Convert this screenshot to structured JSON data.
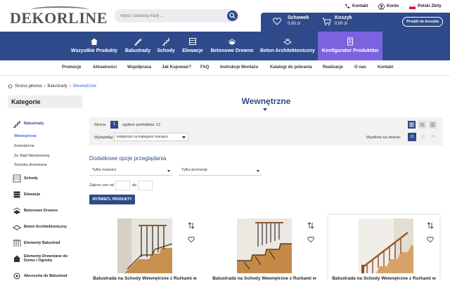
{
  "brand": {
    "logo_text": "DEKORLINE"
  },
  "search": {
    "placeholder": "Wpisz szukaną frazę ..."
  },
  "top_links": {
    "contact": "Kontakt",
    "account": "Konto",
    "language": "Polski Złoty"
  },
  "wishlist": {
    "label": "Schowek",
    "value": "0,00 zł"
  },
  "cart": {
    "label": "Koszyk",
    "value": "0,00 zł",
    "checkout": "Przejdź do koszyka"
  },
  "nav": [
    {
      "label": "Wszystkie Produkty",
      "icon": "home-icon"
    },
    {
      "label": "Balustrady",
      "icon": "stairs-icon"
    },
    {
      "label": "Schody",
      "icon": "stairs-icon"
    },
    {
      "label": "Elewacje",
      "icon": "facade-icon"
    },
    {
      "label": "Betonowe Drewno",
      "icon": "wood-icon"
    },
    {
      "label": "Beton Architektoniczny",
      "icon": "concrete-icon"
    },
    {
      "label": "Konfigurator Produktów",
      "icon": "configurator-icon"
    }
  ],
  "subnav": [
    "Promocje",
    "Aktualności",
    "Współpraca",
    "Jak Kupować?",
    "FAQ",
    "Instrukcje Montażu",
    "Katalogi do pobrania",
    "Realizacje",
    "O nas",
    "Kontakt"
  ],
  "breadcrumb": {
    "home": "Strona główna",
    "parent": "Balustrady",
    "current": "Wewnętrzne"
  },
  "sidebar": {
    "title": "Kategorie",
    "active_category": "Balustrady",
    "subitems": [
      "Wewnętrzne",
      "Zewnętrzne",
      "Ze Stali Nierdzewnej",
      "Ścianka drewniana"
    ],
    "categories": [
      "Schody",
      "Elewacje",
      "Betonowe Drewno",
      "Beton Architektoniczny",
      "Elementy Balustrad",
      "Elementy Drewniane do Domu i Ogrodu",
      "Akcesoria do Balustrad"
    ]
  },
  "page": {
    "title": "Wewnętrzne",
    "page_label": "Strona",
    "page_number": "1",
    "total_label": "ogółem produktów: 12",
    "sort_label": "Wyświetlaj wg",
    "sort_value": "kolejności w kategorii rosnąco",
    "per_page_label": "Wyników na stronie:",
    "per_page_options": [
      "15",
      "30",
      "45"
    ]
  },
  "options": {
    "title": "Dodatkowe opcje przeglądania",
    "new_only": "Tylko nowości",
    "promo_only": "Tylko promocje",
    "price_from": "Zakres cen od",
    "price_to": "do",
    "show_button": "WYŚWIETL PRODUKTY"
  },
  "products": [
    {
      "name": "Balustrada na Schody Wewnętrzne z Rurkami w"
    },
    {
      "name": "Balustrada na Schody Wewnętrzne z Rurkami w"
    },
    {
      "name": "Balustrada na Schody Wewnętrzne z Rurkami w"
    }
  ],
  "colors": {
    "primary": "#2e4a8a",
    "accent": "#7b63e0",
    "link": "#2e6fd1"
  }
}
